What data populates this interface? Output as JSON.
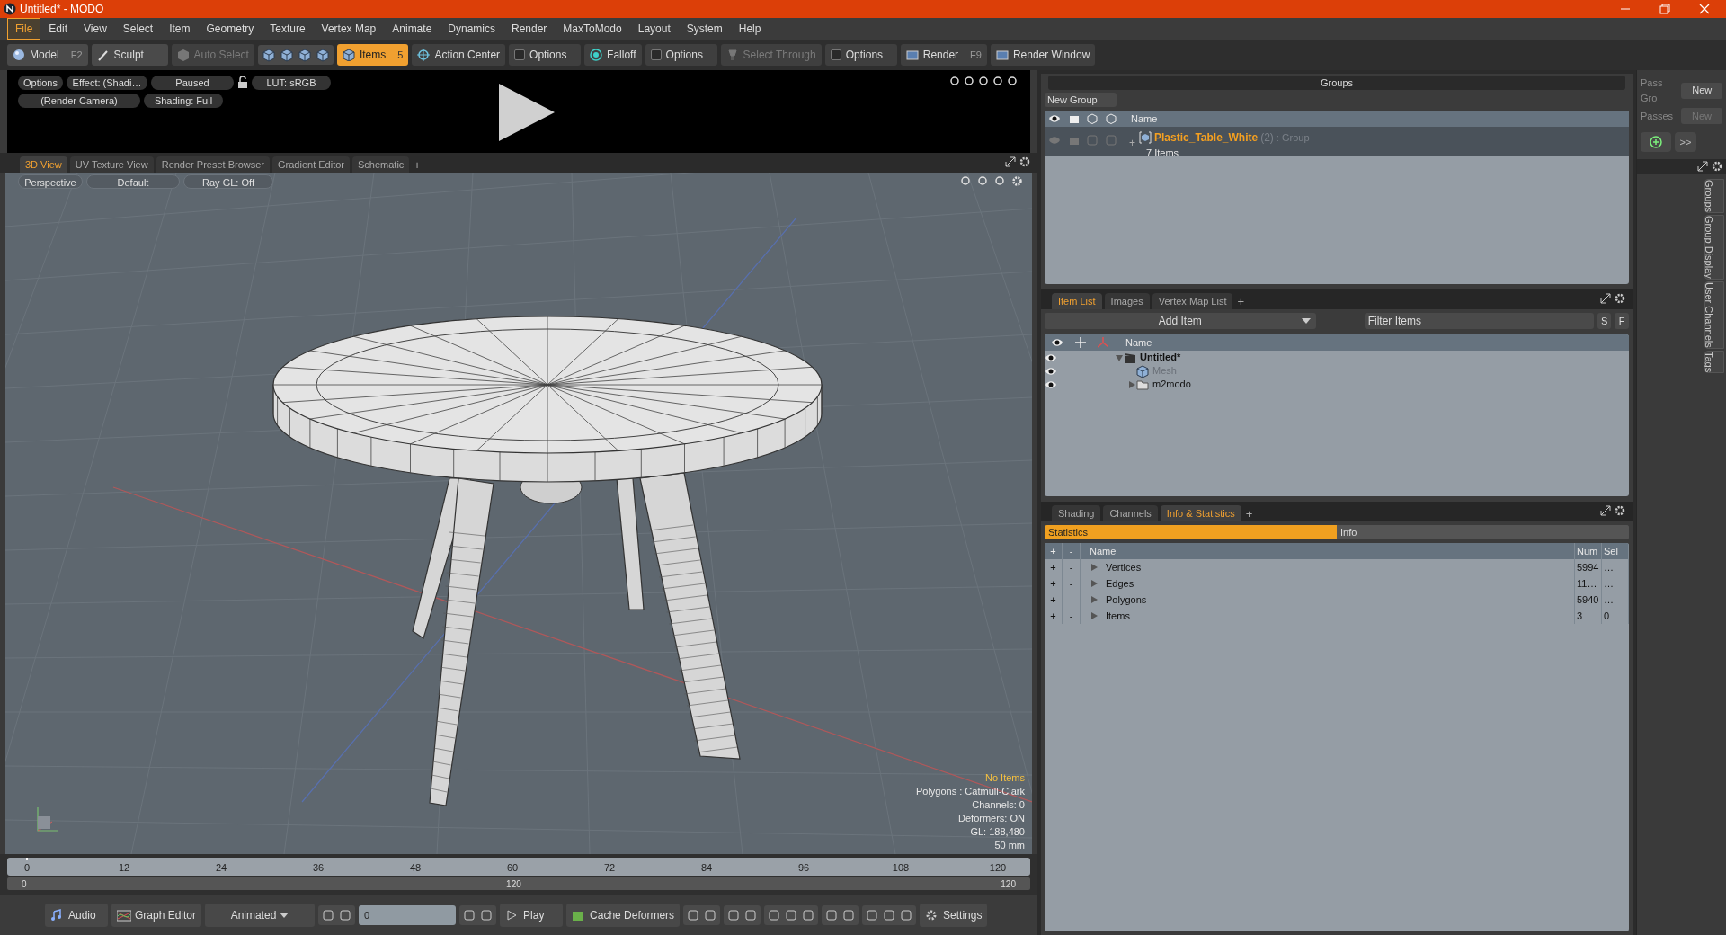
{
  "window": {
    "title": "Untitled* - MODO"
  },
  "menu": [
    {
      "label": "File",
      "selected": true
    },
    {
      "label": "Edit",
      "selected": false
    },
    {
      "label": "View",
      "selected": false
    },
    {
      "label": "Select",
      "selected": false
    },
    {
      "label": "Item",
      "selected": false
    },
    {
      "label": "Geometry",
      "selected": false
    },
    {
      "label": "Texture",
      "selected": false
    },
    {
      "label": "Vertex Map",
      "selected": false
    },
    {
      "label": "Animate",
      "selected": false
    },
    {
      "label": "Dynamics",
      "selected": false
    },
    {
      "label": "Render",
      "selected": false
    },
    {
      "label": "MaxToModo",
      "selected": false
    },
    {
      "label": "Layout",
      "selected": false
    },
    {
      "label": "System",
      "selected": false
    },
    {
      "label": "Help",
      "selected": false
    }
  ],
  "toolbar": [
    {
      "kind": "mode",
      "label": "Model",
      "shortcut": "F2",
      "selected": false
    },
    {
      "kind": "mode",
      "label": "Sculpt",
      "selected": false
    },
    {
      "kind": "button",
      "label": "Auto Select",
      "disabled": true
    },
    {
      "kind": "cubes"
    },
    {
      "kind": "mode",
      "label": "Items",
      "shortcut": "5",
      "selected": true
    },
    {
      "kind": "button",
      "label": "Action Center",
      "disabled": false
    },
    {
      "kind": "option",
      "label": "Options",
      "checked": false
    },
    {
      "kind": "button",
      "label": "Falloff",
      "disabled": false
    },
    {
      "kind": "option",
      "label": "Options",
      "checked": false
    },
    {
      "kind": "button",
      "label": "Select Through",
      "disabled": true
    },
    {
      "kind": "option",
      "label": "Options",
      "checked": false
    },
    {
      "kind": "button",
      "label": "Render",
      "shortcut": "F9",
      "disabled": false
    },
    {
      "kind": "button",
      "label": "Render Window",
      "disabled": false
    }
  ],
  "render_preview": {
    "row1": [
      "Options",
      "Effect: (Shadi…",
      "Paused",
      "LUT: sRGB"
    ],
    "row2": [
      "(Render Camera)",
      "Shading: Full"
    ]
  },
  "viewport": {
    "tabs": [
      {
        "label": "3D View",
        "selected": true
      },
      {
        "label": "UV Texture View",
        "selected": false
      },
      {
        "label": "Render Preset Browser",
        "selected": false
      },
      {
        "label": "Gradient Editor",
        "selected": false
      },
      {
        "label": "Schematic",
        "selected": false
      }
    ],
    "add_tab": "+",
    "toolbar": [
      "Perspective",
      "Default",
      "Ray GL: Off"
    ],
    "info": {
      "title": "No Items",
      "lines": [
        "Polygons : Catmull-Clark",
        "Channels: 0",
        "Deformers: ON",
        "GL: 188,480",
        "50 mm"
      ]
    }
  },
  "timeline": {
    "ticks": [
      "0",
      "12",
      "24",
      "36",
      "48",
      "60",
      "72",
      "84",
      "96",
      "108",
      "120"
    ],
    "range_start": "0",
    "range_mid": "120",
    "range_end": "120"
  },
  "transport": [
    {
      "kind": "button",
      "label": "Audio"
    },
    {
      "kind": "button",
      "label": "Graph Editor"
    },
    {
      "kind": "dropdown",
      "label": "Animated"
    },
    {
      "kind": "frame",
      "value": "0"
    },
    {
      "kind": "button",
      "label": "Play"
    },
    {
      "kind": "button",
      "label": "Cache Deformers"
    },
    {
      "kind": "button",
      "label": "Settings"
    }
  ],
  "groups": {
    "title": "Groups",
    "new_button": "New Group",
    "columns": [
      "Name"
    ],
    "rows": [
      {
        "name": "Plastic_Table_White",
        "count": "(2)",
        "type": ": Group",
        "detail": "7 Items",
        "expand": "+"
      }
    ]
  },
  "item_list": {
    "tabs": [
      {
        "label": "Item List",
        "selected": true
      },
      {
        "label": "Images",
        "selected": false
      },
      {
        "label": "Vertex Map List",
        "selected": false
      }
    ],
    "add_tab": "+",
    "add_item": "Add Item",
    "filter_placeholder": "Filter Items",
    "filter_buttons": [
      "S",
      "F"
    ],
    "columns": [
      "Name"
    ],
    "tree": [
      {
        "name": "Untitled*",
        "kind": "scene",
        "expanded": true,
        "children": [
          {
            "name": "Mesh",
            "kind": "mesh",
            "disabled": true
          },
          {
            "name": "m2modo",
            "kind": "folder",
            "expanded": false,
            "disabled": false
          }
        ]
      }
    ]
  },
  "info_panel": {
    "tabs": [
      {
        "label": "Shading",
        "selected": false
      },
      {
        "label": "Channels",
        "selected": false
      },
      {
        "label": "Info & Statistics",
        "selected": true
      }
    ],
    "add_tab": "+",
    "subtabs": [
      {
        "label": "Statistics",
        "selected": true
      },
      {
        "label": "Info",
        "selected": false
      }
    ],
    "columns": [
      "+",
      "-",
      "Name",
      "Num",
      "Sel"
    ],
    "rows": [
      {
        "add": "+",
        "remove": "-",
        "name": "Vertices",
        "num": "5994",
        "sel": "…"
      },
      {
        "add": "+",
        "remove": "-",
        "name": "Edges",
        "num": "11…",
        "sel": "…"
      },
      {
        "add": "+",
        "remove": "-",
        "name": "Polygons",
        "num": "5940",
        "sel": "…"
      },
      {
        "add": "+",
        "remove": "-",
        "name": "Items",
        "num": "3",
        "sel": "0"
      }
    ]
  },
  "passes": {
    "rows": [
      {
        "label": "Pass Gro",
        "button": "New",
        "disabled": false
      },
      {
        "label": "Passes",
        "button": "New",
        "disabled": true
      }
    ],
    "more": ">>",
    "side_tabs": [
      "Groups",
      "Group Display",
      "User Channels",
      "Tags"
    ]
  }
}
